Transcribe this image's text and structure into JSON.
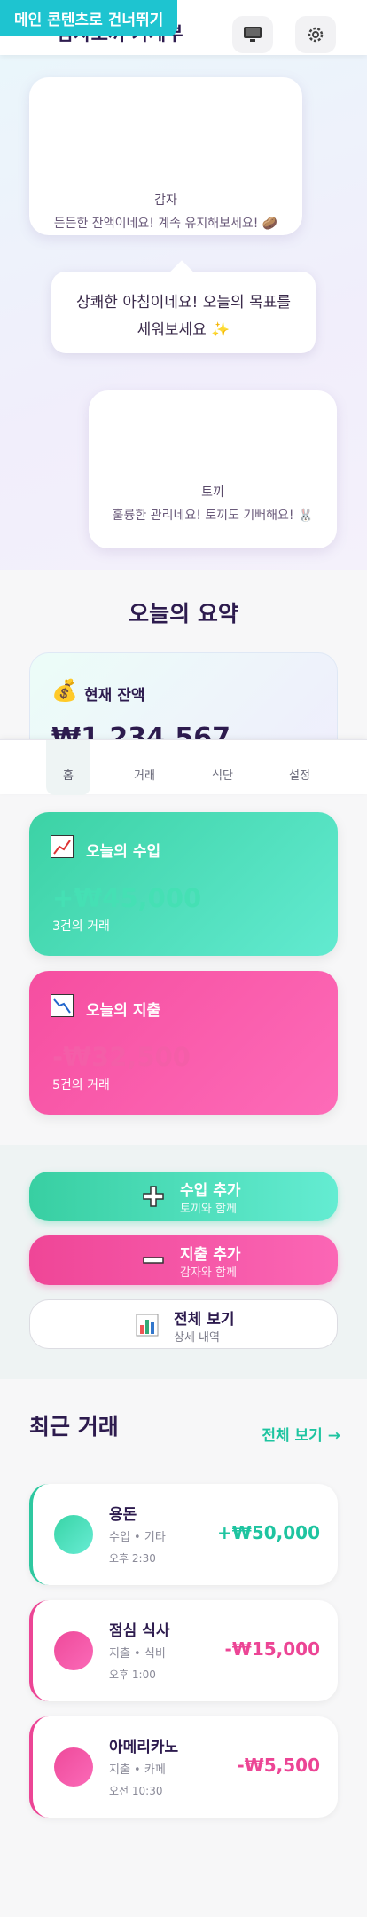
{
  "skip_link": "메인 콘텐츠로 건너뛰기",
  "header": {
    "title": "감자토끼 가계부",
    "screen_icon": "monitor-icon",
    "settings_icon": "gear-icon"
  },
  "characters": [
    {
      "name": "감자",
      "message": "든든한 잔액이네요! 계속 유지해보세요! 🥔"
    },
    {
      "name": "토끼",
      "message": "훌륭한 관리네요! 토끼도 기뻐해요! 🐰"
    }
  ],
  "bubble": {
    "line1": "상쾌한 아침이네요! 오늘의 목표를",
    "line2": "세워보세요 ✨"
  },
  "summary": {
    "title": "오늘의 요약",
    "balance_icon": "💰",
    "balance_label": "현재 잔액",
    "balance_value": "₩1,234,567",
    "income_label": "오늘의 수입",
    "income_value": "+₩45,000",
    "income_count": "3건의 거래",
    "expense_label": "오늘의 지출",
    "expense_value": "-₩32,500",
    "expense_count": "5건의 거래"
  },
  "nav": [
    "홈",
    "거래",
    "식단",
    "설정"
  ],
  "actions": {
    "income": {
      "title": "수입 추가",
      "subtitle": "토끼와 함께"
    },
    "expense": {
      "title": "지출 추가",
      "subtitle": "감자와 함께"
    },
    "all": {
      "title": "전체 보기",
      "subtitle": "상세 내역"
    }
  },
  "recent": {
    "title": "최근 거래",
    "view_all": "전체 보기 →",
    "items": [
      {
        "name": "용돈",
        "meta": "수입 • 기타",
        "time": "오후 2:30",
        "amount": "+₩50,000"
      },
      {
        "name": "점심 식사",
        "meta": "지출 • 식비",
        "time": "오후 1:00",
        "amount": "-₩15,000"
      },
      {
        "name": "아메리카노",
        "meta": "지출 • 카페",
        "time": "오전 10:30",
        "amount": "-₩5,500"
      }
    ]
  },
  "colors": {
    "income": "#1ec4a0",
    "expense": "#ec4595",
    "accent": "#1ec4d0",
    "text": "#2d1b4e"
  }
}
